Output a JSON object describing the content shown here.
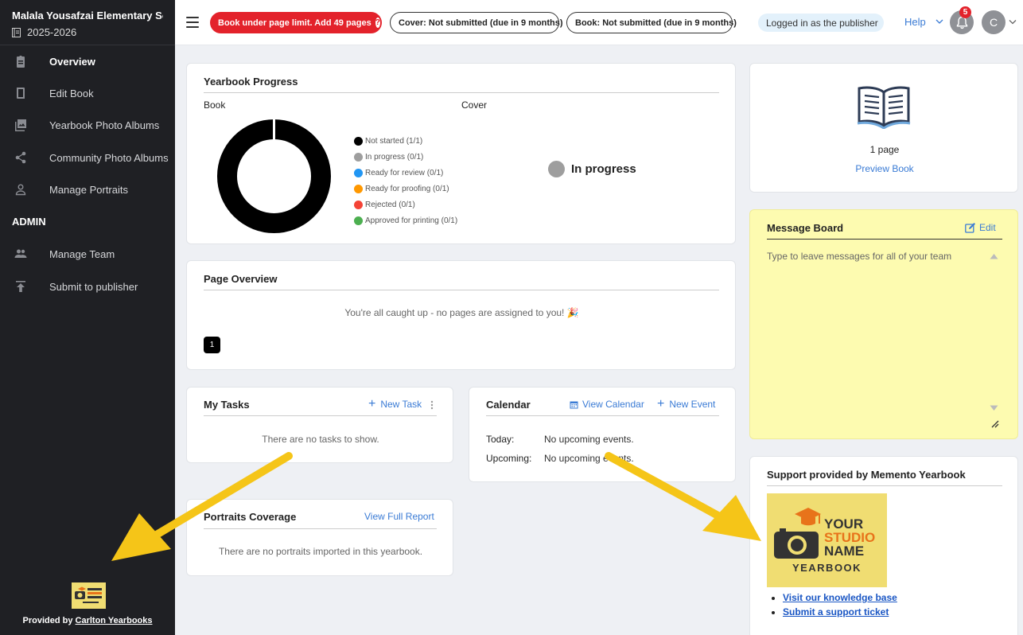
{
  "sidebar": {
    "school": "Malala Yousafzai Elementary Sch...",
    "year": "2025-2026",
    "items": [
      {
        "label": "Overview"
      },
      {
        "label": "Edit Book"
      },
      {
        "label": "Yearbook Photo Albums"
      },
      {
        "label": "Community Photo Albums"
      },
      {
        "label": "Manage Portraits"
      }
    ],
    "admin_label": "ADMIN",
    "admin_items": [
      {
        "label": "Manage Team"
      },
      {
        "label": "Submit to publisher"
      }
    ],
    "footer_prefix": "Provided by ",
    "footer_link": "Carlton Yearbooks"
  },
  "topbar": {
    "alert": "Book under page limit. Add 49 pages",
    "alert_icon": "?",
    "cover_status": "Cover: Not submitted (due in 9 months)",
    "book_status": "Book: Not submitted (due in 9 months)",
    "publisher": "Logged in as the publisher",
    "help": "Help",
    "notifications": "5",
    "avatar": "C"
  },
  "progress": {
    "title": "Yearbook Progress",
    "book_label": "Book",
    "cover_label": "Cover",
    "legend": [
      {
        "label": "Not started (1/1)",
        "color": "#000000"
      },
      {
        "label": "In progress (0/1)",
        "color": "#9e9e9e"
      },
      {
        "label": "Ready for review (0/1)",
        "color": "#2196f3"
      },
      {
        "label": "Ready for proofing (0/1)",
        "color": "#ff9800"
      },
      {
        "label": "Rejected (0/1)",
        "color": "#f44336"
      },
      {
        "label": "Approved for printing (0/1)",
        "color": "#4caf50"
      }
    ],
    "cover_state": "In progress",
    "cover_state_color": "#9e9e9e"
  },
  "preview": {
    "pages": "1 page",
    "link": "Preview Book"
  },
  "page_overview": {
    "title": "Page Overview",
    "message": "You're all caught up - no pages are assigned to you! 🎉",
    "page_number": "1"
  },
  "tasks": {
    "title": "My Tasks",
    "new_task": "New Task",
    "empty": "There are no tasks to show."
  },
  "calendar": {
    "title": "Calendar",
    "view": "View Calendar",
    "new_event": "New Event",
    "today_label": "Today:",
    "today_value": "No upcoming events.",
    "upcoming_label": "Upcoming:",
    "upcoming_value": "No upcoming events."
  },
  "portraits": {
    "title": "Portraits Coverage",
    "report": "View Full Report",
    "empty": "There are no portraits imported in this yearbook."
  },
  "message_board": {
    "title": "Message Board",
    "edit": "Edit",
    "placeholder": "Type to leave messages for all of your team"
  },
  "support": {
    "title": "Support provided by Memento Yearbook",
    "logo_line1": "YOUR",
    "logo_line2": "STUDIO",
    "logo_line3": "NAME",
    "logo_line4": "YEARBOOK",
    "links": [
      "Visit our knowledge base",
      "Submit a support ticket"
    ]
  },
  "colors": {
    "sidebar_bg": "#1f2024",
    "accent": "#3a7bd5",
    "alert": "#e3222b",
    "arrow": "#f5c518"
  }
}
